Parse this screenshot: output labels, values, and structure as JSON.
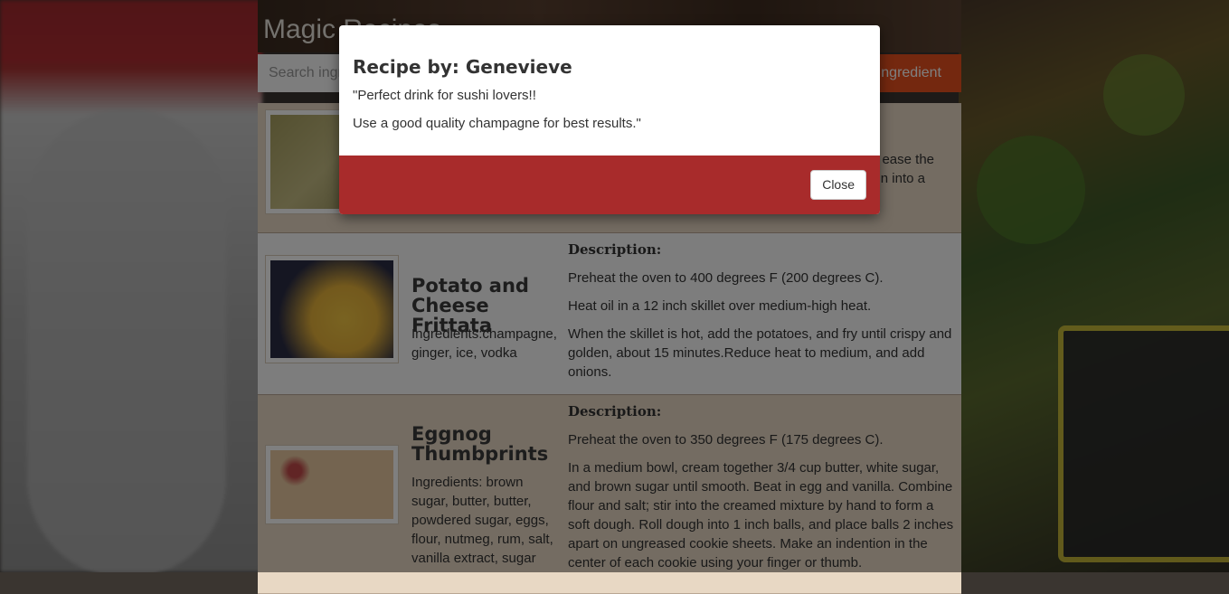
{
  "app": {
    "brand": "Magic Recipes"
  },
  "search": {
    "placeholder": "Search ingredients",
    "button_label": "Add Ingredient"
  },
  "recipes": [
    {
      "title": "",
      "ingredients": "",
      "description_fragment_1": "ease the",
      "description_fragment_2": "n into a"
    },
    {
      "title": "Potato and Cheese Frittata",
      "ingredients": "Ingredients:champagne, ginger, ice, vodka",
      "description_label": "Description:",
      "description": [
        "Preheat the oven to 400 degrees F (200 degrees C).",
        "Heat oil in a 12 inch skillet over medium-high heat.",
        "When the skillet is hot, add the potatoes, and fry until crispy and golden, about 15 minutes.Reduce heat to medium, and add onions."
      ]
    },
    {
      "title": "Eggnog Thumbprints",
      "ingredients": "Ingredients: brown sugar, butter, butter, powdered sugar, eggs, flour, nutmeg, rum, salt, vanilla extract, sugar",
      "description_label": "Description:",
      "description": [
        "Preheat the oven to 350 degrees F (175 degrees C).",
        "In a medium bowl, cream together 3/4 cup butter, white sugar, and brown sugar until smooth. Beat in egg and vanilla. Combine flour and salt; stir into the creamed mixture by hand to form a soft dough. Roll dough into 1 inch balls, and place balls 2 inches apart on ungreased cookie sheets. Make an indention in the center of each cookie using your finger or thumb."
      ]
    }
  ],
  "modal": {
    "title": "Recipe by: Genevieve",
    "line1": "\"Perfect drink for sushi lovers!!",
    "line2": "Use a good quality champagne for best results.\"",
    "close_label": "Close",
    "footer_color": "#a82b2b"
  },
  "colors": {
    "accent": "#e8501e",
    "card_tan": "#e8d8c4",
    "modal_footer": "#a82b2b"
  }
}
